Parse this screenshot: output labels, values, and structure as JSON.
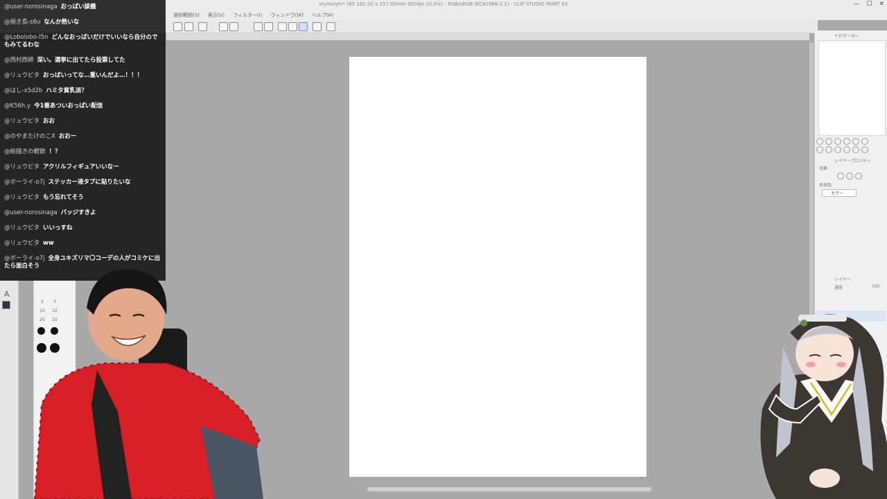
{
  "window": {
    "title": "srymizym* (B5 182.00 x 257.00mm 600dpi 20.0%) - RGB/sRGB IEC61966-2.1) - CLIP STUDIO PAINT EX",
    "minimize_glyph": "—",
    "maximize_glyph": "☐",
    "close_glyph": "✕"
  },
  "menu": [
    "選択範囲(S)",
    "表示(V)",
    "フィルター(I)",
    "ウィンドウ(W)",
    "ヘルプ(H)"
  ],
  "chat": [
    {
      "author": "@user-norosinaga",
      "message": "おっぱい談義"
    },
    {
      "author": "@焼き鳥-s6u",
      "message": "なんか熱いな"
    },
    {
      "author": "@Lobolobo-l5n",
      "message": "どんなおっぱいだけでいいなら自分のでもみてるわな"
    },
    {
      "author": "@西村西師",
      "message": "深い。選挙に出てたら投票してた"
    },
    {
      "author": "@リュウビタ",
      "message": "おっぱいってな…重いんだよ…！！！"
    },
    {
      "author": "@はし-x5d2b",
      "message": "ハミタ貧乳派？"
    },
    {
      "author": "@K56h.y",
      "message": "今1番あついおっぱい配信"
    },
    {
      "author": "@リュウビタ",
      "message": "おお"
    },
    {
      "author": "@のやまたけのこX",
      "message": "おおー"
    },
    {
      "author": "@絵描きの鰹節",
      "message": "！？"
    },
    {
      "author": "@リュウビタ",
      "message": "アクリルフィギュアいいなー"
    },
    {
      "author": "@ボーライ-o7j",
      "message": "ステッカー液タブに貼りたいな"
    },
    {
      "author": "@リュウビタ",
      "message": "もう忘れてそう"
    },
    {
      "author": "@user-norosinaga",
      "message": "バッジすきよ"
    },
    {
      "author": "@リュウビタ",
      "message": "いいっすね"
    },
    {
      "author": "@リュウビタ",
      "message": "ww"
    },
    {
      "author": "@ボーライ-o7j",
      "message": "全身ユキズリマ〇コーデの人がコミケに出たら面白そう"
    }
  ],
  "left_tools": {
    "text_tool": "A",
    "brush_numbers": [
      "2",
      "3",
      "10",
      "12",
      "20",
      "22"
    ]
  },
  "right_panel": {
    "navigator_tab": "ナビゲーター",
    "layer_property_tab": "レイヤープロパティ",
    "effect_label": "効果",
    "expression_color_label": "表現色",
    "color_mode": "カラー",
    "layer_tab": "レイヤー",
    "blend_mode": "通常",
    "opacity": "100"
  },
  "colors": {
    "canvas": "#ffffff",
    "workspace": "#a9a9a9",
    "chat_bg": "#0c0c0c",
    "shirt": "#d81f26",
    "habit": "#3d3732"
  }
}
